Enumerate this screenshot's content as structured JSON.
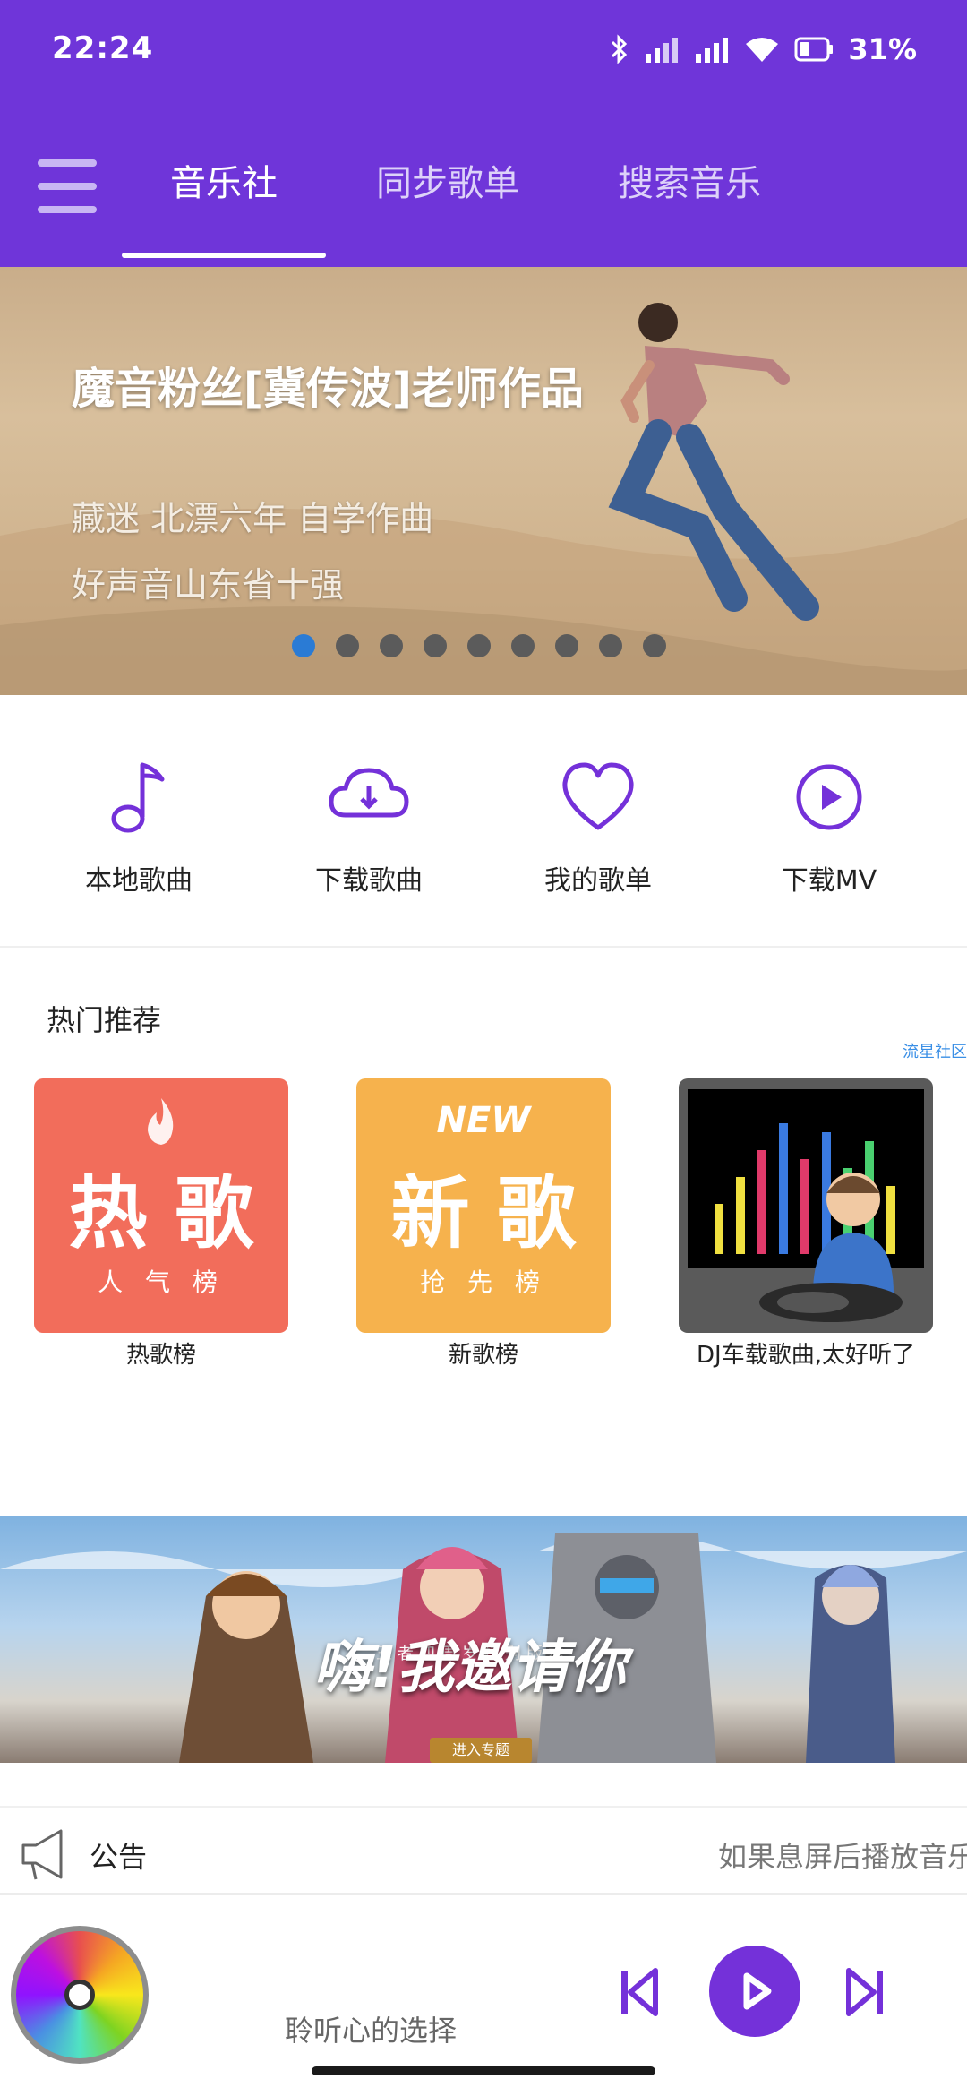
{
  "status_bar": {
    "time": "22:24",
    "battery": "31%"
  },
  "nav": {
    "tabs": [
      "音乐社",
      "同步歌单",
      "搜索音乐"
    ],
    "active_tab": 0
  },
  "banner": {
    "title": "魔音粉丝[冀传波]老师作品",
    "lines": [
      "藏迷 北漂六年 自学作曲",
      "好声音山东省十强"
    ],
    "dot_count": 9,
    "active_dot": 0
  },
  "quick_actions": [
    {
      "label": "本地歌曲",
      "icon": "music-note-icon"
    },
    {
      "label": "下载歌曲",
      "icon": "cloud-download-icon"
    },
    {
      "label": "我的歌单",
      "icon": "heart-icon"
    },
    {
      "label": "下载MV",
      "icon": "play-circle-icon"
    }
  ],
  "hot": {
    "title": "热门推荐",
    "ad_tag": "流星社区",
    "cards": [
      {
        "big": "热 歌",
        "small": "人 气 榜",
        "caption": "热歌榜"
      },
      {
        "tag": "NEW",
        "big": "新 歌",
        "small": "抢 先 榜",
        "caption": "新歌榜"
      },
      {
        "caption": "DJ车载歌曲,太好听了"
      }
    ]
  },
  "game_ad": {
    "slogan": "嗨!我邀请你",
    "sub": "王者四周岁特别版本",
    "button": "进入专题"
  },
  "notice": {
    "label": "公告",
    "text": "如果息屏后播放音乐"
  },
  "player": {
    "title": "聆听心的选择"
  },
  "colors": {
    "primary": "#6f35d9",
    "accent": "#7431d9",
    "active_dot": "#2a7bd5"
  }
}
